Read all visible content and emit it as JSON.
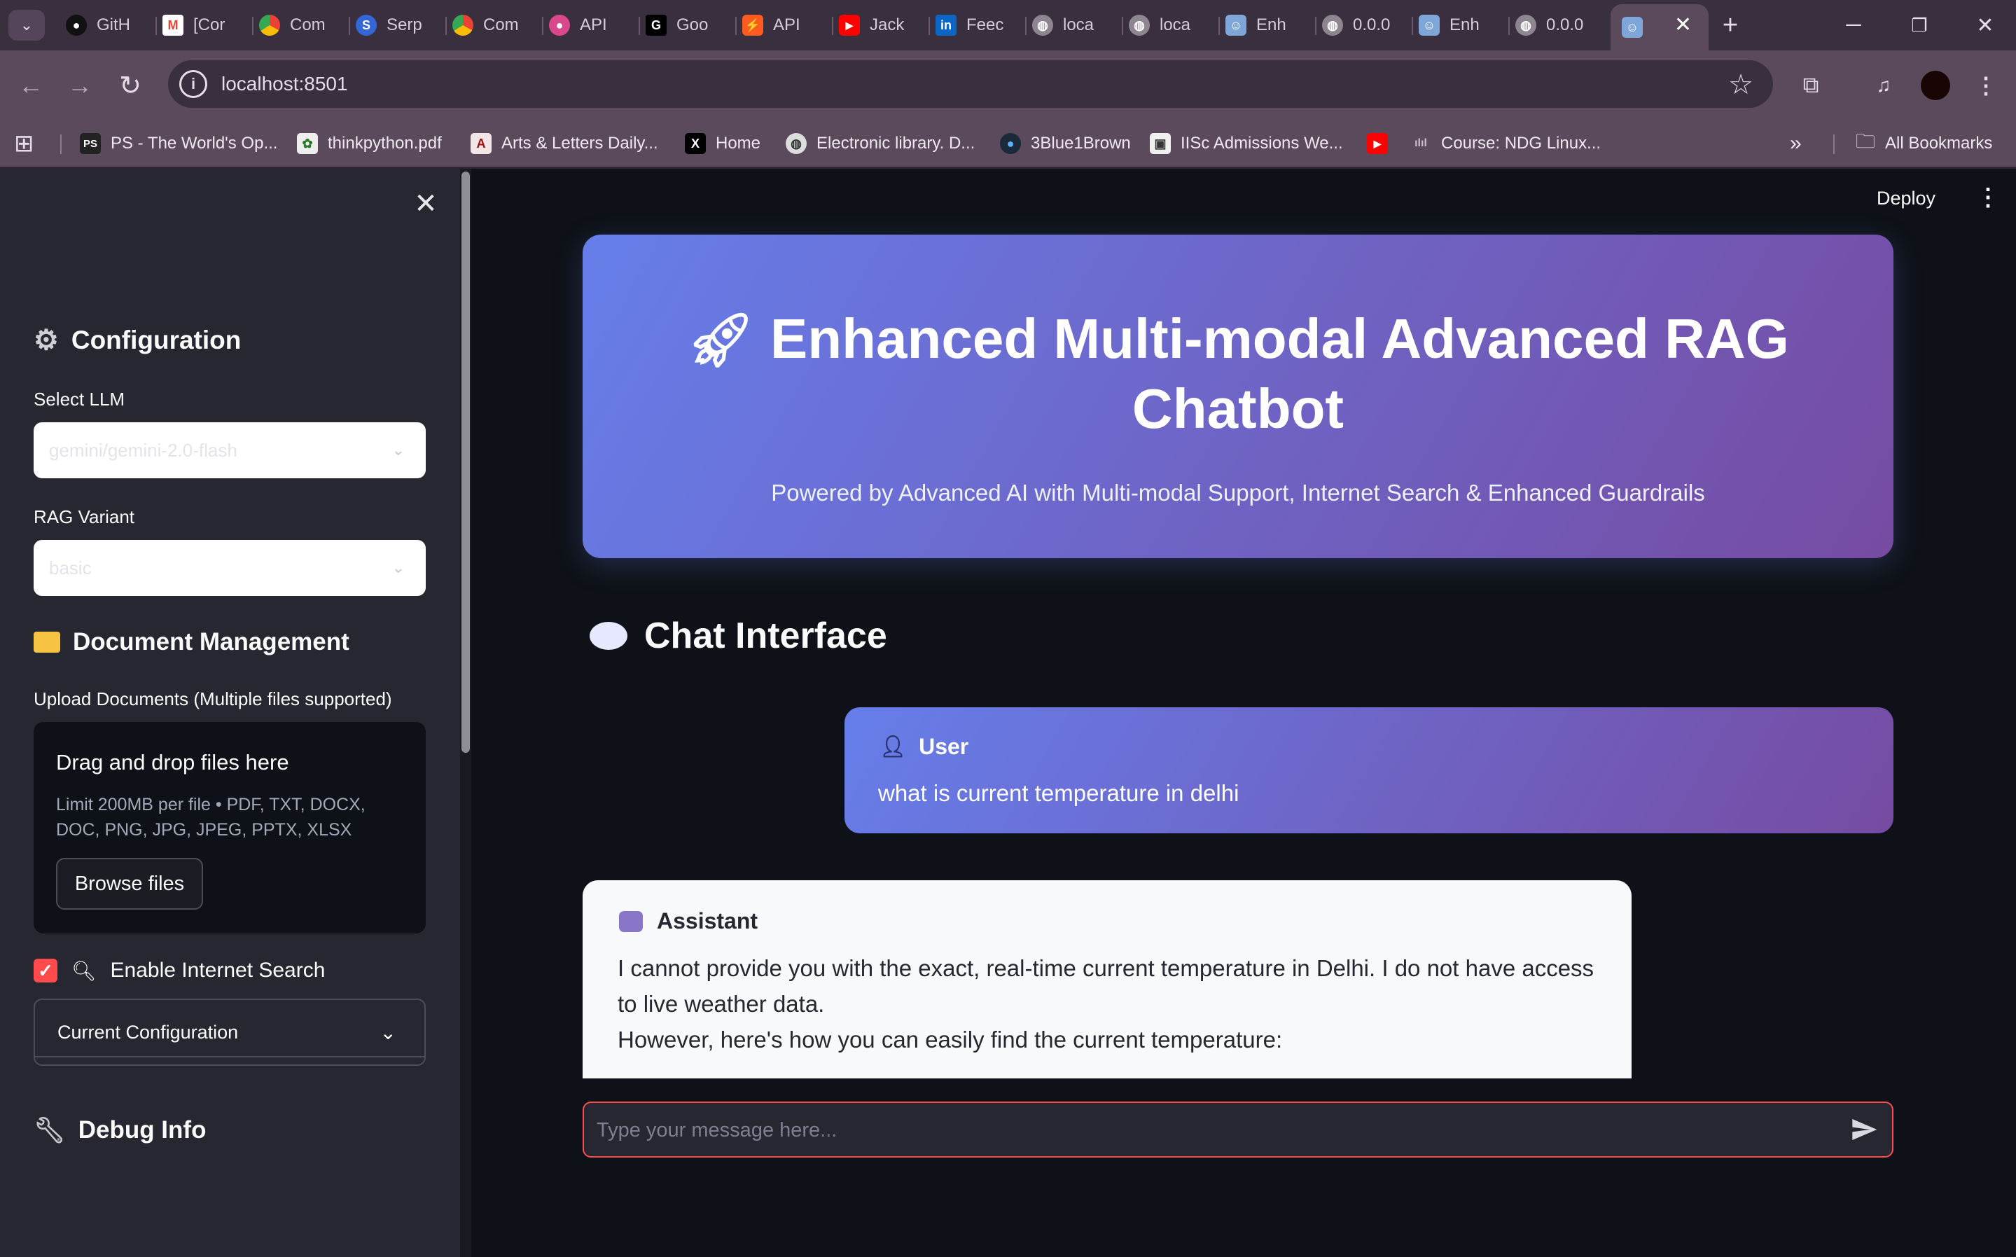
{
  "browser": {
    "tabs": [
      {
        "label": "GitH",
        "icon": "github-icon"
      },
      {
        "label": "[Cor",
        "icon": "gmail-icon"
      },
      {
        "label": "Com",
        "icon": "chrome-icon"
      },
      {
        "label": "Serp",
        "icon": "serp-icon"
      },
      {
        "label": "Com",
        "icon": "chrome-icon"
      },
      {
        "label": "API",
        "icon": "api-icon"
      },
      {
        "label": "Goo",
        "icon": "google-icon"
      },
      {
        "label": "API",
        "icon": "api-icon"
      },
      {
        "label": "Jack",
        "icon": "youtube-icon"
      },
      {
        "label": "Feec",
        "icon": "linkedin-icon"
      },
      {
        "label": "loca",
        "icon": "globe-icon"
      },
      {
        "label": "loca",
        "icon": "globe-icon"
      },
      {
        "label": "Enh",
        "icon": "robot-icon"
      },
      {
        "label": "0.0.0",
        "icon": "globe-icon"
      },
      {
        "label": "Enh",
        "icon": "robot-icon"
      },
      {
        "label": "0.0.0",
        "icon": "globe-icon"
      }
    ],
    "active_tab_icon": "robot-icon",
    "url": "localhost:8501",
    "bookmarks": [
      {
        "label": "PS - The World's Op...",
        "icon": "ps-icon"
      },
      {
        "label": "thinkpython.pdf",
        "icon": "pdf-icon"
      },
      {
        "label": "Arts & Letters Daily...",
        "icon": "arts-icon"
      },
      {
        "label": "Home",
        "icon": "x-icon"
      },
      {
        "label": "Electronic library. D...",
        "icon": "globe-icon"
      },
      {
        "label": "3Blue1Brown",
        "icon": "3b1b-icon"
      },
      {
        "label": "IISc Admissions We...",
        "icon": "iisc-icon"
      },
      {
        "label": "",
        "icon": "youtube-icon"
      },
      {
        "label": "Course: NDG Linux...",
        "icon": "cisco-icon"
      }
    ],
    "all_bookmarks_label": "All Bookmarks"
  },
  "sidebar": {
    "config_title": "Configuration",
    "select_llm_label": "Select LLM",
    "select_llm_value": "gemini/gemini-2.0-flash",
    "rag_variant_label": "RAG Variant",
    "rag_variant_value": "basic",
    "doc_mgmt_title": "Document Management",
    "upload_label": "Upload Documents (Multiple files supported)",
    "drop_title": "Drag and drop files here",
    "drop_limits": "Limit 200MB per file • PDF, TXT, DOCX, DOC, PNG, JPG, JPEG, PPTX, XLSX",
    "browse_label": "Browse files",
    "internet_search_label": "Enable Internet Search",
    "internet_search_checked": true,
    "debug_title": "Debug Info",
    "current_config_label": "Current Configuration"
  },
  "header": {
    "deploy_label": "Deploy"
  },
  "hero": {
    "title": "Enhanced Multi-modal Advanced RAG Chatbot",
    "subtitle": "Powered by Advanced AI with Multi-modal Support, Internet Search & Enhanced Guardrails",
    "gradient_start": "#667eea",
    "gradient_end": "#764ba2"
  },
  "chat": {
    "title": "Chat Interface",
    "messages": [
      {
        "role": "User",
        "text": "what is current temperature in delhi"
      },
      {
        "role": "Assistant",
        "lines": [
          "I cannot provide you with the exact, real-time current temperature in Delhi. I do not have access to live weather data.",
          "However, here's how you can easily find the current temperature:"
        ]
      }
    ],
    "input_placeholder": "Type your message here...",
    "accent": "#ff4b4b"
  }
}
